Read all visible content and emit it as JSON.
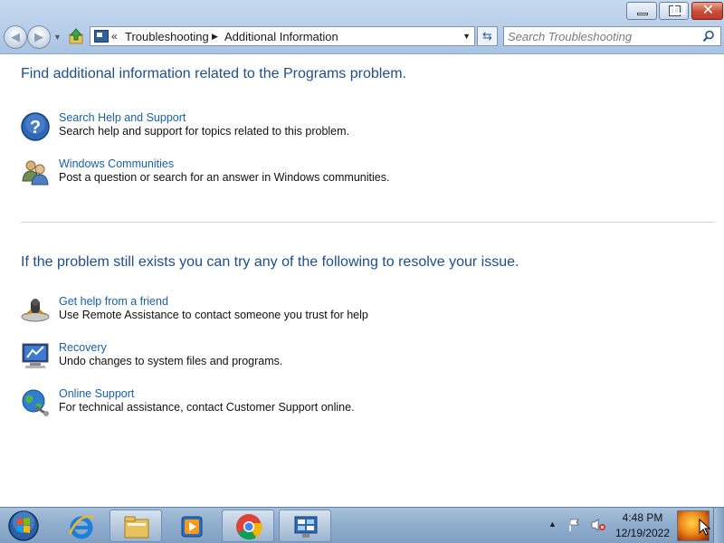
{
  "window": {
    "breadcrumb": {
      "overflow_glyph": "«",
      "items": [
        "Troubleshooting",
        "Additional Information"
      ]
    },
    "search": {
      "placeholder": "Search Troubleshooting"
    }
  },
  "main": {
    "heading1": "Find additional information related to the Programs problem.",
    "section1": [
      {
        "link": "Search Help and Support",
        "description": "Search help and support for topics related to this problem.",
        "icon": "help-question-icon"
      },
      {
        "link": "Windows Communities",
        "description": "Post a question or search for an answer in Windows communities.",
        "icon": "people-icon"
      }
    ],
    "heading2": "If the problem still exists you can try any of the following to resolve your issue.",
    "section2": [
      {
        "link": "Get help from a friend",
        "description": "Use Remote Assistance to contact someone you trust for help",
        "icon": "remote-assistance-icon"
      },
      {
        "link": "Recovery",
        "description": "Undo changes to system files and programs.",
        "icon": "recovery-monitor-icon"
      },
      {
        "link": "Online Support",
        "description": "For technical assistance, contact Customer Support online.",
        "icon": "globe-icon"
      }
    ]
  },
  "taskbar": {
    "items": [
      "start-orb-icon",
      "internet-explorer-icon",
      "file-explorer-icon",
      "media-player-icon",
      "chrome-icon",
      "troubleshooting-icon"
    ],
    "clock": {
      "time": "4:48 PM",
      "date": "12/19/2022"
    }
  },
  "colors": {
    "heading": "#1f4e8c",
    "link": "#1a5fa8",
    "taskbar": "#93b0cf",
    "close_button": "#c74e35"
  }
}
